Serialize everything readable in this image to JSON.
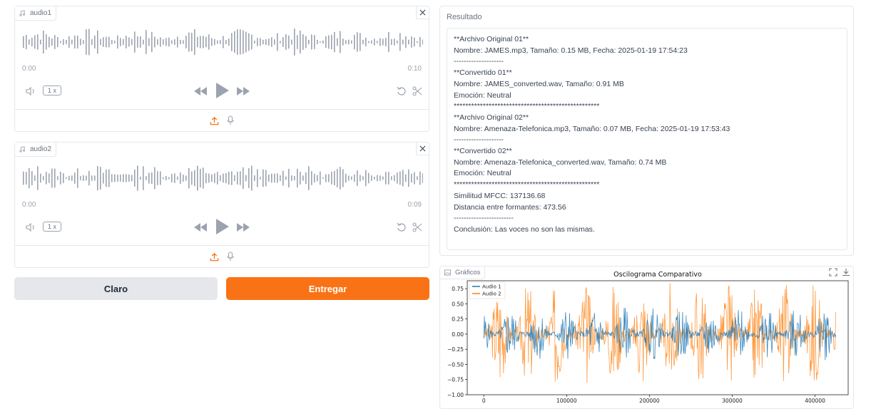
{
  "audio1": {
    "label": "audio1",
    "time_start": "0:00",
    "time_end": "0:10",
    "speed": "1 x"
  },
  "audio2": {
    "label": "audio2",
    "time_start": "0:00",
    "time_end": "0:09",
    "speed": "1 x"
  },
  "buttons": {
    "clear": "Claro",
    "submit": "Entregar"
  },
  "result": {
    "label": "Resultado",
    "lines": [
      "**Archivo Original 01**",
      "Nombre: JAMES.mp3, Tamaño: 0.15 MB, Fecha: 2025-01-19 17:54:23",
      "--------------------",
      "**Convertido 01**",
      "Nombre: JAMES_converted.wav, Tamaño: 0.91 MB",
      "Emoción: Neutral",
      "**************************************************",
      "**Archivo Original 02**",
      "Nombre: Amenaza-Telefonica.mp3, Tamaño: 0.07 MB, Fecha: 2025-01-19 17:53:43",
      "--------------------",
      "**Convertido 02**",
      "Nombre: Amenaza-Telefonica_converted.wav, Tamaño: 0.74 MB",
      "Emoción: Neutral",
      "**************************************************",
      "Similitud MFCC: 137136.68",
      "Distancia entre formantes: 473.56",
      "------------------------",
      "Conclusión: Las voces no son las mismas."
    ]
  },
  "chart_panel_label": "Gráficos",
  "colors": {
    "accent": "#f97316",
    "series1": "#1f77b4",
    "series2": "#ff7f0e"
  },
  "chart_data": {
    "type": "line",
    "title": "Oscilograma Comparativo",
    "xlabel": "",
    "ylabel": "",
    "xlim": [
      -20000,
      440000
    ],
    "ylim": [
      -1.0,
      0.88
    ],
    "xticks": [
      0,
      100000,
      200000,
      300000,
      400000
    ],
    "xtick_labels": [
      "0",
      "100000",
      "200000",
      "300000",
      "400000"
    ],
    "yticks": [
      0.75,
      0.5,
      0.25,
      0.0,
      -0.25,
      -0.5,
      -0.75,
      -1.0
    ],
    "ytick_labels": [
      "0.75",
      "0.50",
      "0.25",
      "0.00",
      "−0.25",
      "−0.50",
      "−0.75",
      "−1.00"
    ],
    "legend_position": "top-left",
    "series": [
      {
        "name": "Audio 1",
        "x_end": 425000,
        "amplitude_approx": 0.45
      },
      {
        "name": "Audio 2",
        "x_end": 425000,
        "amplitude_approx": 0.9
      }
    ]
  }
}
